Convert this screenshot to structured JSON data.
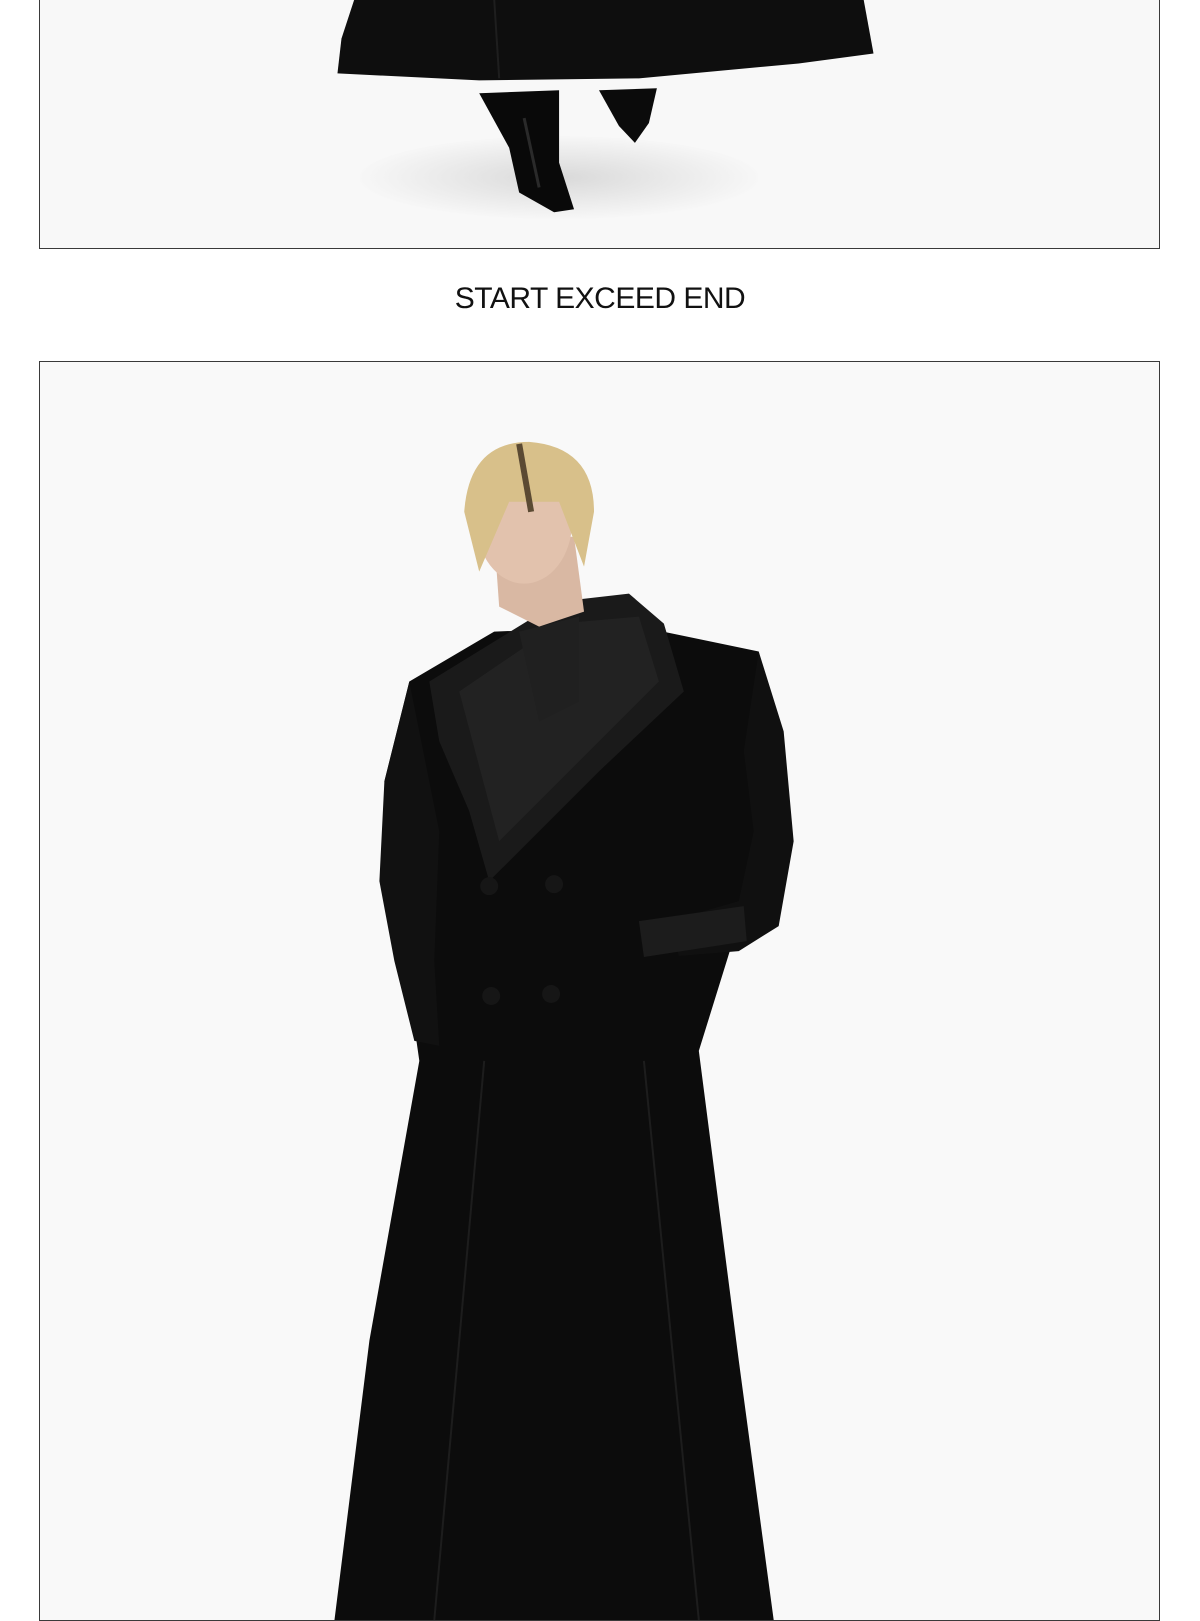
{
  "caption": {
    "text": "START EXCEED END"
  },
  "photos": [
    {
      "name": "top-photo",
      "subject": "hem-of-long-black-coat-and-boots"
    },
    {
      "name": "bottom-photo",
      "subject": "model-in-long-black-coat-with-fur-collar"
    }
  ],
  "colors": {
    "background": "#ffffff",
    "frame_border": "#3a3a3a",
    "coat": "#0d0d0d",
    "caption_text": "#111111"
  }
}
